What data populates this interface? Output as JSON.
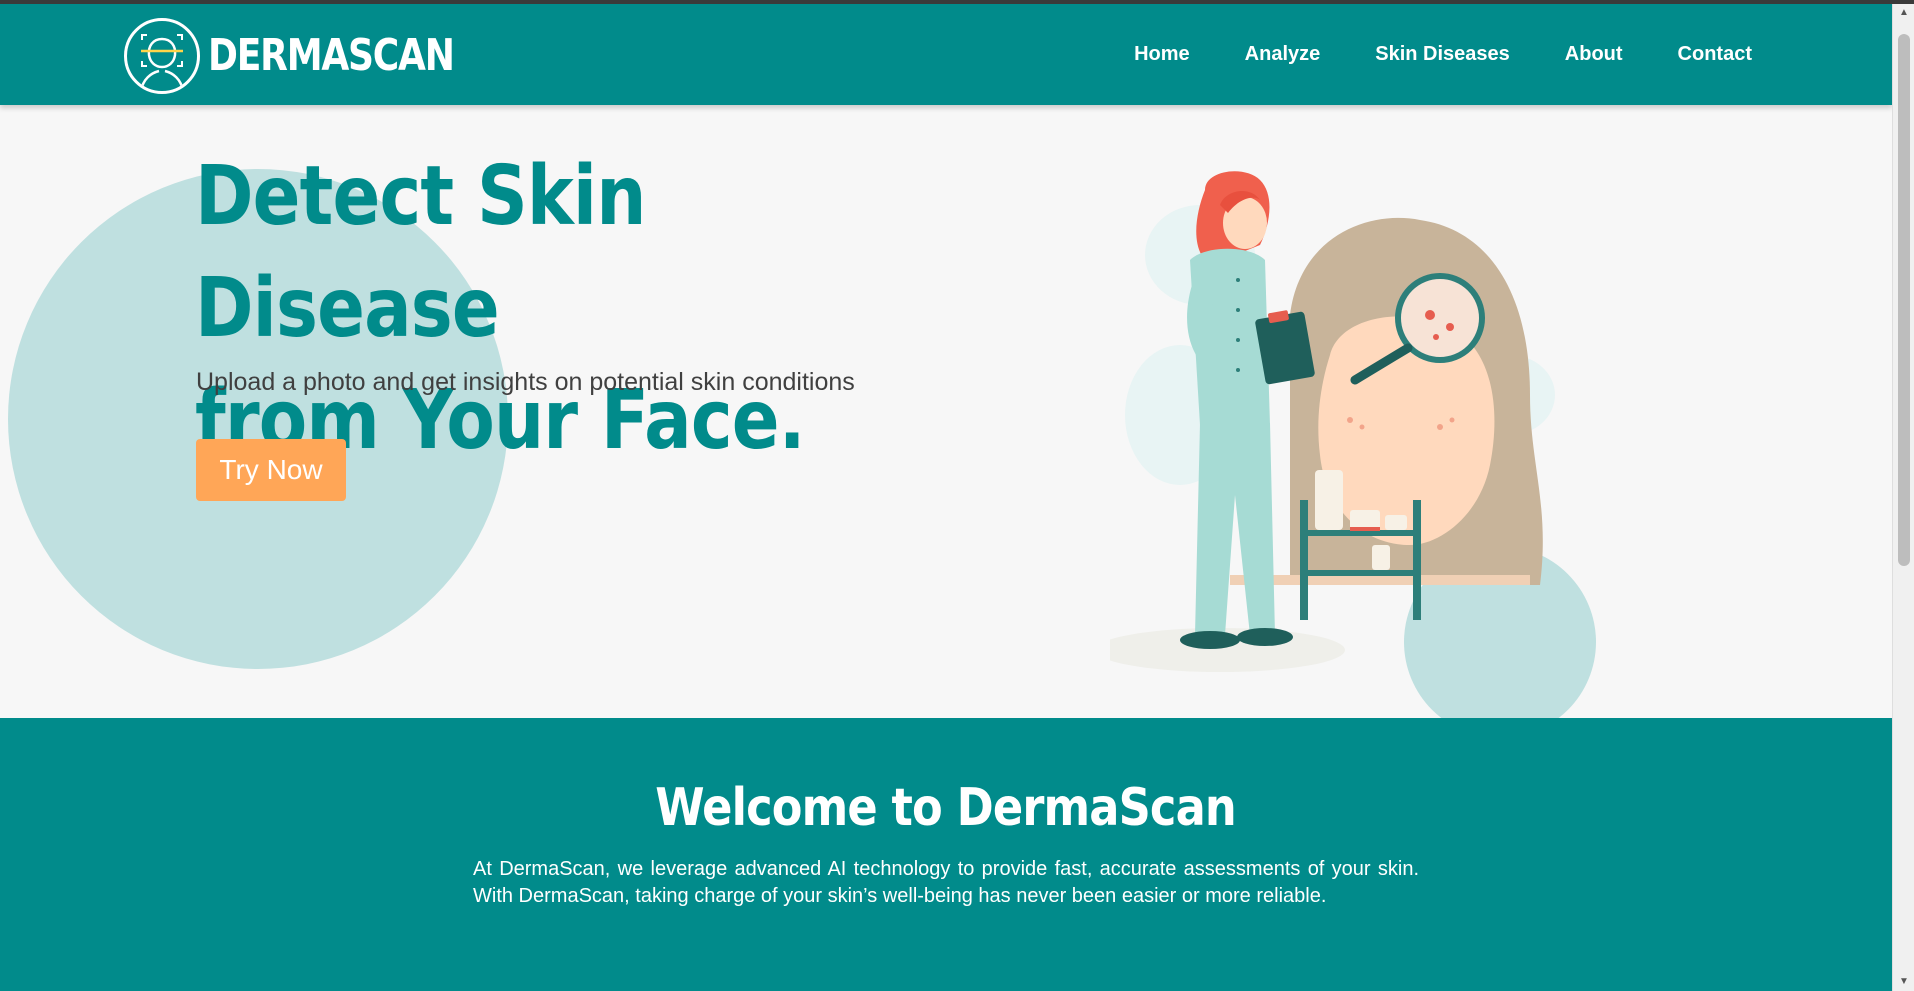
{
  "brand": {
    "name": "DERMASCAN",
    "logo_icon": "face-scan-icon"
  },
  "nav": {
    "items": [
      {
        "label": "Home"
      },
      {
        "label": "Analyze"
      },
      {
        "label": "Skin Diseases"
      },
      {
        "label": "About"
      },
      {
        "label": "Contact"
      }
    ]
  },
  "hero": {
    "title_line1": "Detect Skin Disease",
    "title_line2": "from Your Face.",
    "subtitle": "Upload a photo and get insights on potential skin conditions",
    "cta_label": "Try Now"
  },
  "welcome": {
    "title": "Welcome to DermaScan",
    "text": "At DermaScan, we leverage advanced AI technology to provide fast, accurate assessments of your skin. With DermaScan, taking charge of your skin’s well-being has never been easier or more reliable."
  },
  "colors": {
    "primary": "#018b8b",
    "accent": "#ffa657",
    "hero_bg": "#f7f7f7",
    "circle": "#bfe0e0"
  }
}
